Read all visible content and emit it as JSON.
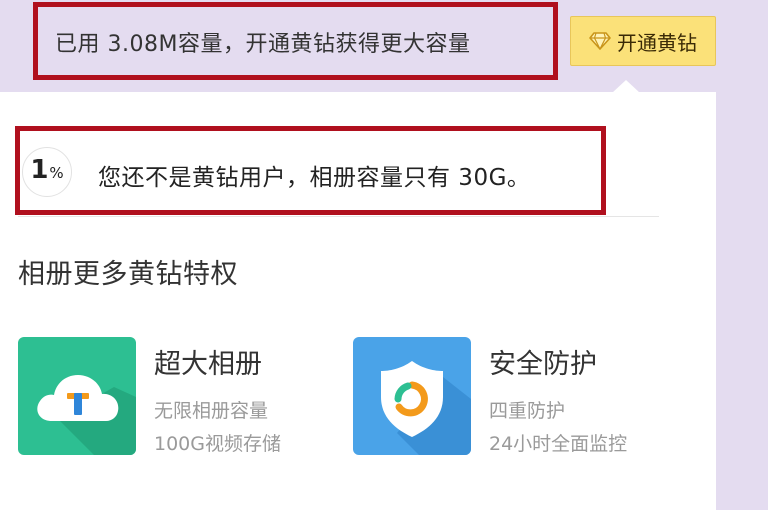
{
  "colors": {
    "page_background": "#e4dcf0",
    "highlight_border": "#b0101e",
    "button_background": "#fbe179",
    "tile_green": "#2dbf92",
    "tile_blue": "#4aa3e8"
  },
  "header": {
    "usage_text": "已用 3.08M容量，开通黄钻获得更大容量",
    "upgrade_button": {
      "icon": "diamond-icon",
      "label": "开通黄钻"
    }
  },
  "notice": {
    "progress_number": "1",
    "progress_suffix": "%",
    "progress_fraction": 0.01,
    "text": "您还不是黄钻用户，相册容量只有 30G。"
  },
  "privileges": {
    "title": "相册更多黄钻特权",
    "items": [
      {
        "icon": "cloud-t-icon",
        "title": "超大相册",
        "line1": "无限相册容量",
        "line2": "100G视频存储"
      },
      {
        "icon": "shield-icon",
        "title": "安全防护",
        "line1": "四重防护",
        "line2": "24小时全面监控"
      }
    ]
  }
}
